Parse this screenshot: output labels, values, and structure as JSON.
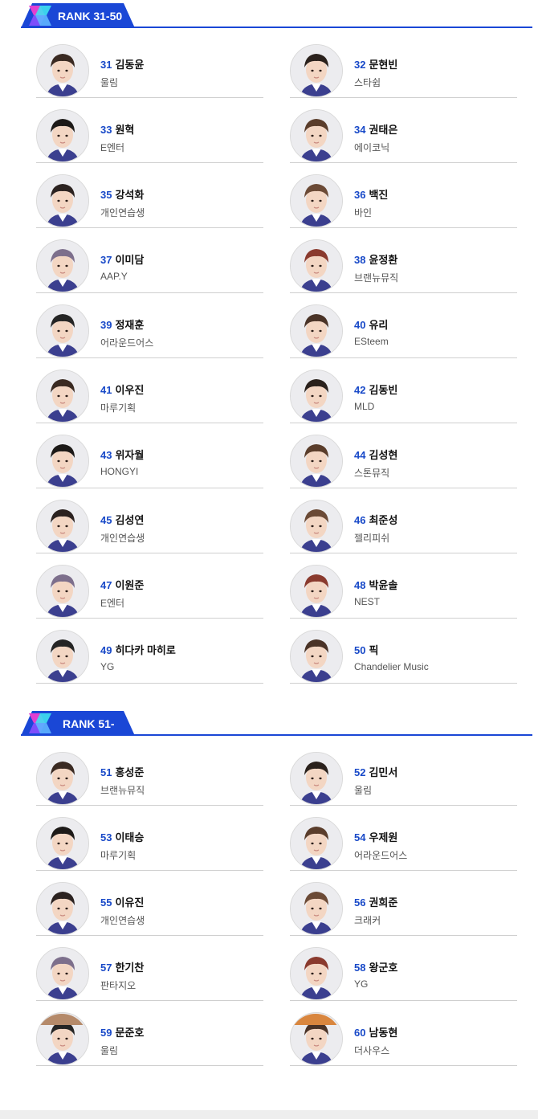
{
  "sections": [
    {
      "title": "RANK 31-50",
      "trainees": [
        {
          "rank": "31",
          "name": "김동윤",
          "agency": "울림"
        },
        {
          "rank": "32",
          "name": "문현빈",
          "agency": "스타쉽"
        },
        {
          "rank": "33",
          "name": "원혁",
          "agency": "E엔터"
        },
        {
          "rank": "34",
          "name": "권태은",
          "agency": "에이코닉"
        },
        {
          "rank": "35",
          "name": "강석화",
          "agency": "개인연습생"
        },
        {
          "rank": "36",
          "name": "백진",
          "agency": "바인"
        },
        {
          "rank": "37",
          "name": "이미담",
          "agency": "AAP.Y"
        },
        {
          "rank": "38",
          "name": "윤정환",
          "agency": "브랜뉴뮤직"
        },
        {
          "rank": "39",
          "name": "정재훈",
          "agency": "어라운드어스"
        },
        {
          "rank": "40",
          "name": "유리",
          "agency": "ESteem"
        },
        {
          "rank": "41",
          "name": "이우진",
          "agency": "마루기획"
        },
        {
          "rank": "42",
          "name": "김동빈",
          "agency": "MLD"
        },
        {
          "rank": "43",
          "name": "위자월",
          "agency": "HONGYI"
        },
        {
          "rank": "44",
          "name": "김성현",
          "agency": "스톤뮤직"
        },
        {
          "rank": "45",
          "name": "김성연",
          "agency": "개인연습생"
        },
        {
          "rank": "46",
          "name": "최준성",
          "agency": "젤리피쉬"
        },
        {
          "rank": "47",
          "name": "이원준",
          "agency": "E엔터"
        },
        {
          "rank": "48",
          "name": "박윤솔",
          "agency": "NEST"
        },
        {
          "rank": "49",
          "name": "히다카 마히로",
          "agency": "YG"
        },
        {
          "rank": "50",
          "name": "픽",
          "agency": "Chandelier Music"
        }
      ]
    },
    {
      "title": "RANK 51-",
      "trainees": [
        {
          "rank": "51",
          "name": "홍성준",
          "agency": "브랜뉴뮤직"
        },
        {
          "rank": "52",
          "name": "김민서",
          "agency": "울림"
        },
        {
          "rank": "53",
          "name": "이태승",
          "agency": "마루기획"
        },
        {
          "rank": "54",
          "name": "우제원",
          "agency": "어라운드어스"
        },
        {
          "rank": "55",
          "name": "이유진",
          "agency": "개인연습생"
        },
        {
          "rank": "56",
          "name": "권희준",
          "agency": "크래커"
        },
        {
          "rank": "57",
          "name": "한기찬",
          "agency": "판타지오"
        },
        {
          "rank": "58",
          "name": "왕군호",
          "agency": "YG"
        },
        {
          "rank": "59",
          "name": "문준호",
          "agency": "울림"
        },
        {
          "rank": "60",
          "name": "남동현",
          "agency": "더사우스"
        }
      ]
    }
  ],
  "colors": {
    "accent_blue": "#1a47d6",
    "rank_number": "#1849c8",
    "logo_pink": "#e23fd1",
    "logo_cyan": "#3fe0f0"
  },
  "icons": {
    "section_logo": "x-logo-icon",
    "avatar": "trainee-photo-icon"
  }
}
